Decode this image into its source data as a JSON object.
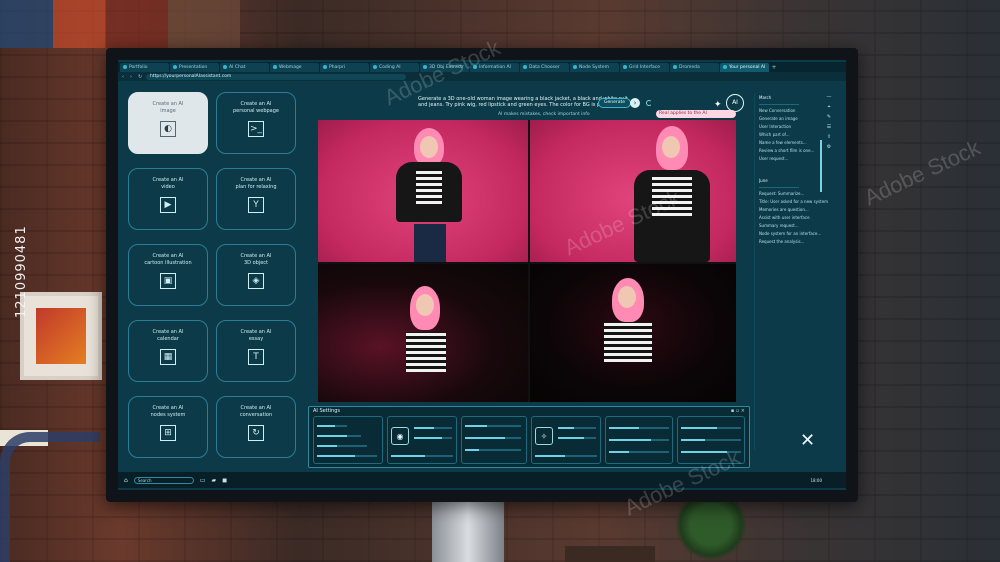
{
  "side_watermark": "1210990481",
  "tabs": [
    "Portfolio",
    "Presentation",
    "AI Chat",
    "Webmage",
    "Pharpri",
    "Coding AI",
    "3D Obj Extractr",
    "Information AI",
    "Data Chooser",
    "Node System",
    "Grid Interface",
    "Dromeda",
    "Your personal AI"
  ],
  "url": "https://yourpersonalAIassistant.com",
  "tools": [
    {
      "line1": "Create an AI",
      "line2": "image",
      "icon": "palette-icon",
      "glyph": "◐",
      "selected": true
    },
    {
      "line1": "Create an AI",
      "line2": "personal webpage",
      "icon": "terminal-icon",
      "glyph": ">_",
      "selected": false
    },
    {
      "line1": "Create an AI",
      "line2": "video",
      "icon": "play-icon",
      "glyph": "▶",
      "selected": false
    },
    {
      "line1": "Create an AI",
      "line2": "plan for relaxing",
      "icon": "cocktail-icon",
      "glyph": "Y",
      "selected": false
    },
    {
      "line1": "Create an AI",
      "line2": "cartoon illustration",
      "icon": "image-icon",
      "glyph": "▣",
      "selected": false
    },
    {
      "line1": "Create an AI",
      "line2": "3D object",
      "icon": "cube-icon",
      "glyph": "◈",
      "selected": false
    },
    {
      "line1": "Create an AI",
      "line2": "calendar",
      "icon": "calendar-icon",
      "glyph": "▦",
      "selected": false
    },
    {
      "line1": "Create an AI",
      "line2": "essay",
      "icon": "text-icon",
      "glyph": "T",
      "selected": false
    },
    {
      "line1": "Create an AI",
      "line2": "nodes system",
      "icon": "nodes-icon",
      "glyph": "⊞",
      "selected": false
    },
    {
      "line1": "Create an AI",
      "line2": "conversation",
      "icon": "refresh-icon",
      "glyph": "↻",
      "selected": false
    }
  ],
  "prompt": {
    "text": "Generate a 3D one-old woman image wearing a black jacket, a black and white suit and jeans. Try pink wig, red lipstick and green eyes. The color for BG is pink.",
    "subtext": "AI makes mistakes, check important info",
    "generate_label": "Generate",
    "tooltip": "Real applies to the AI"
  },
  "ai_badge": "AI",
  "settings": {
    "title": "AI Settings"
  },
  "right_panel": {
    "group1": [
      "March",
      "New Conversation",
      "Generate an image",
      "User Interaction",
      "Which part of...",
      "Name a few elements...",
      "Review a short film is one...",
      "User request..."
    ],
    "group2": [
      "June",
      "Request: Summarize...",
      "Title: User asked for a new system",
      "Memories are question...",
      "Assist with user interface",
      "Summary request...",
      "Node system for an interface...",
      "Request the analysis..."
    ]
  },
  "bottom": {
    "search_placeholder": "Search",
    "clock": "18:00"
  },
  "colors": {
    "screen_bg": "#0c3a48",
    "accent": "#3ab5cc",
    "photo_bg": "#c3285f",
    "hair": "#ff8ab4"
  }
}
